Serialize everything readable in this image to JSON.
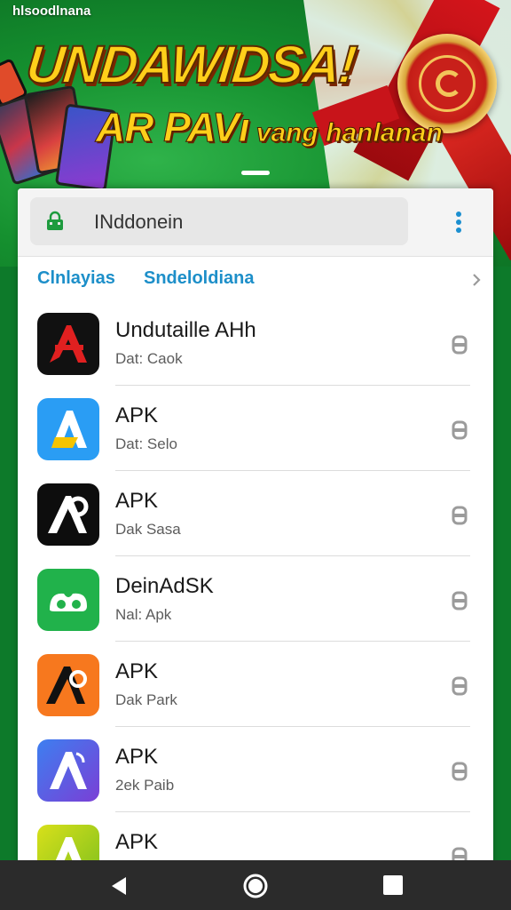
{
  "status_bar": {
    "text": "hlsoodlnana"
  },
  "banner": {
    "headline": "UNDAWIDSA!",
    "sub_big": "AR PAVı",
    "sub_small": "vang hanlanan"
  },
  "search": {
    "value": "INddonein",
    "icon": "lock-bag-icon"
  },
  "breadcrumb": {
    "item1": "Clnlayias",
    "item2": "Sndeloldiana"
  },
  "apps": [
    {
      "name": "Undutaille AHh",
      "sub": "Dat: Caok",
      "icon": "app-icon-red-a",
      "bg": "#111111",
      "fg": "#e02020"
    },
    {
      "name": "APK",
      "sub": "Dat: Selo",
      "icon": "app-icon-blue-a",
      "bg": "#2a9df4",
      "fg": "#ffffff"
    },
    {
      "name": "APK",
      "sub": "Dak Sasa",
      "icon": "app-icon-black-a",
      "bg": "#0d0d0d",
      "fg": "#ffffff"
    },
    {
      "name": "DeinAdSK",
      "sub": "Nal: Apk",
      "icon": "app-icon-green-loop",
      "bg": "#21b24b",
      "fg": "#ffffff"
    },
    {
      "name": "APK",
      "sub": "Dak Park",
      "icon": "app-icon-orange-a",
      "bg": "#f7781e",
      "fg": "#111111"
    },
    {
      "name": "APK",
      "sub": "2ek Paib",
      "icon": "app-icon-violet-a",
      "bg": "#5a58e0",
      "fg": "#ffffff"
    },
    {
      "name": "APK",
      "sub": "",
      "icon": "app-icon-lime-a",
      "bg": "#b8d21a",
      "fg": "#ffffff"
    }
  ],
  "colors": {
    "accent": "#1d8fc9",
    "banner_green": "#15902f",
    "headline_yellow": "#ffcf1a",
    "navbar": "#2b2b2b"
  }
}
